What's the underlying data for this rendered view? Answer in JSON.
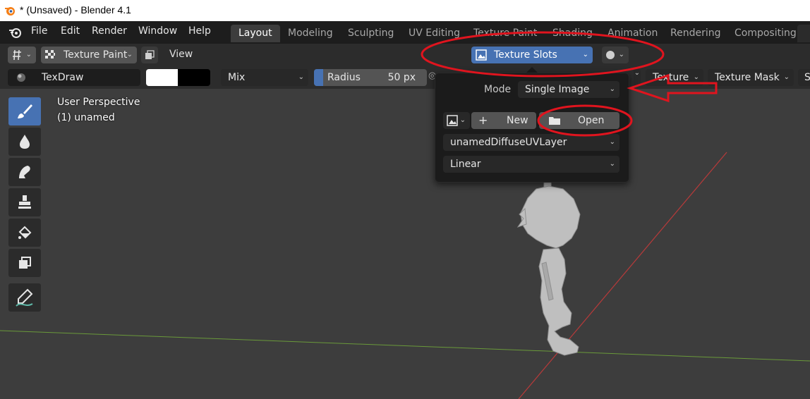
{
  "window": {
    "title": "* (Unsaved) - Blender 4.1"
  },
  "menu": [
    "File",
    "Edit",
    "Render",
    "Window",
    "Help"
  ],
  "workspace_tabs": [
    "Layout",
    "Modeling",
    "Sculpting",
    "UV Editing",
    "Texture Paint",
    "Shading",
    "Animation",
    "Rendering",
    "Compositing"
  ],
  "header": {
    "mode_label": "Texture Paint",
    "view_label": "View",
    "texture_slots_label": "Texture Slots"
  },
  "tool_settings": {
    "brush_name": "TexDraw",
    "blend_mode": "Mix",
    "radius_label": "Radius",
    "radius_value": "50 px",
    "texture_label": "Texture",
    "texture_mask_label": "Texture Mask",
    "stroke_partial": "S"
  },
  "viewport": {
    "perspective": "User Perspective",
    "object": "(1) unamed"
  },
  "texture_slots_popup": {
    "mode_label": "Mode",
    "mode_value": "Single Image",
    "new_label": "New",
    "open_label": "Open",
    "uv_layer": "unamedDiffuseUVLayer",
    "interpolation": "Linear"
  },
  "tools": [
    "draw",
    "soften",
    "smear",
    "clone",
    "fill",
    "mask",
    "annotate"
  ],
  "colors": {
    "accent": "#4772b3",
    "annotation_red": "#e0141e",
    "axis_x": "#b83a3a",
    "axis_y": "#6a9a3a"
  }
}
